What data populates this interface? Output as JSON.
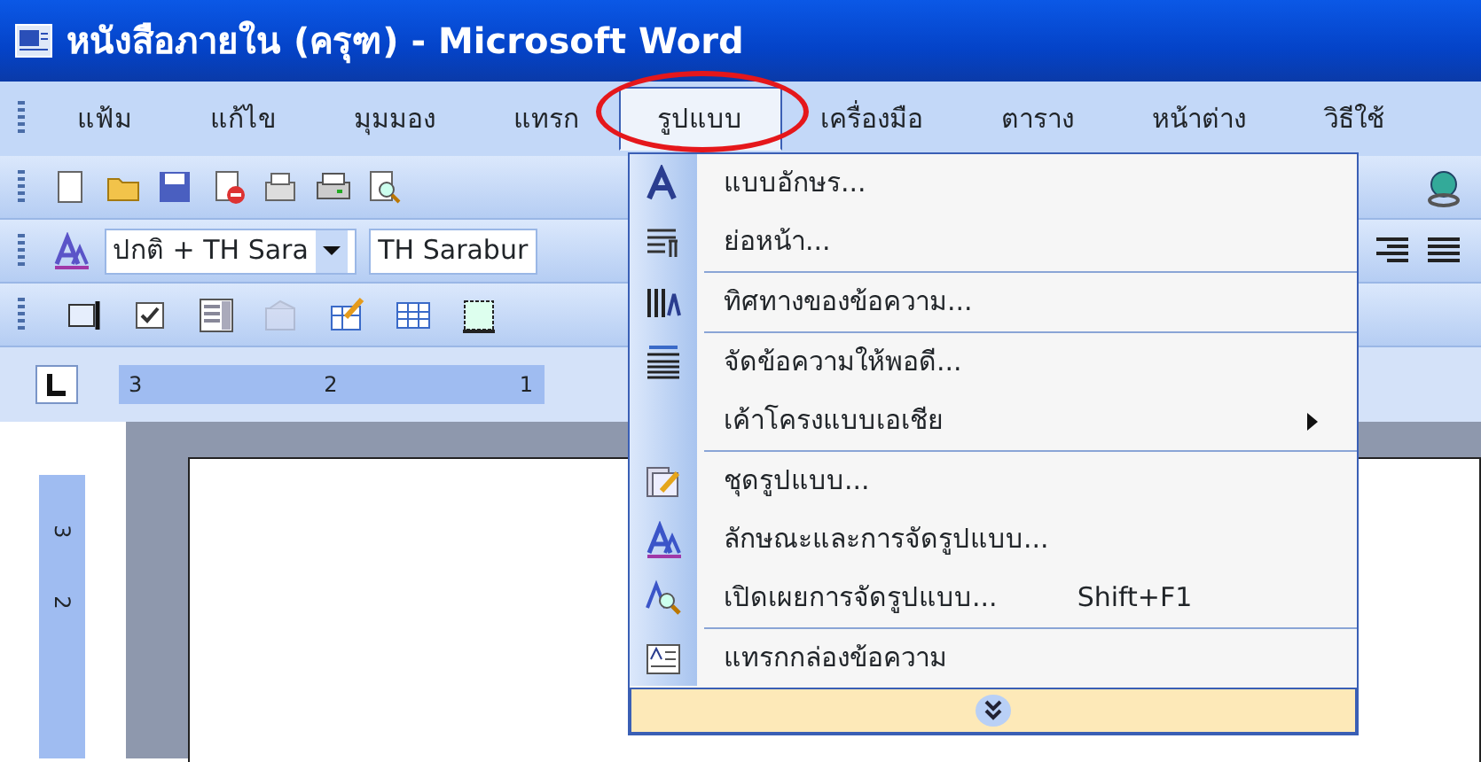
{
  "window": {
    "title": "หนังสือภายใน (ครุฑ) - Microsoft Word"
  },
  "menu_bar": [
    {
      "label": "แฟ้ม",
      "selected": false
    },
    {
      "label": "แก้ไข",
      "selected": false
    },
    {
      "label": "มุมมอง",
      "selected": false
    },
    {
      "label": "แทรก",
      "selected": false
    },
    {
      "label": "รูปแบบ",
      "selected": true
    },
    {
      "label": "เครื่องมือ",
      "selected": false
    },
    {
      "label": "ตาราง",
      "selected": false
    },
    {
      "label": "หน้าต่าง",
      "selected": false
    },
    {
      "label": "วิธีใช้",
      "selected": false
    }
  ],
  "formatting_toolbar": {
    "style": "ปกติ + TH Sara",
    "font": "TH Sarabur"
  },
  "ruler": {
    "horizontal": [
      "3",
      "2",
      "1"
    ],
    "vertical": [
      "3",
      "2"
    ]
  },
  "format_menu": {
    "items": [
      {
        "kind": "command",
        "label": "แบบอักษร..."
      },
      {
        "kind": "command",
        "label": "ย่อหน้า..."
      },
      {
        "kind": "separator"
      },
      {
        "kind": "command",
        "label": "ทิศทางของข้อความ..."
      },
      {
        "kind": "separator"
      },
      {
        "kind": "command",
        "label": "จัดข้อความให้พอดี..."
      },
      {
        "kind": "submenu",
        "label": "เค้าโครงแบบเอเชีย"
      },
      {
        "kind": "separator"
      },
      {
        "kind": "command",
        "label": "ชุดรูปแบบ..."
      },
      {
        "kind": "command",
        "label": "ลักษณะและการจัดรูปแบบ..."
      },
      {
        "kind": "command",
        "label": "เปิดเผยการจัดรูปแบบ...",
        "shortcut": "Shift+F1"
      },
      {
        "kind": "separator"
      },
      {
        "kind": "command",
        "label": "แทรกกล่องข้อความ"
      }
    ]
  }
}
